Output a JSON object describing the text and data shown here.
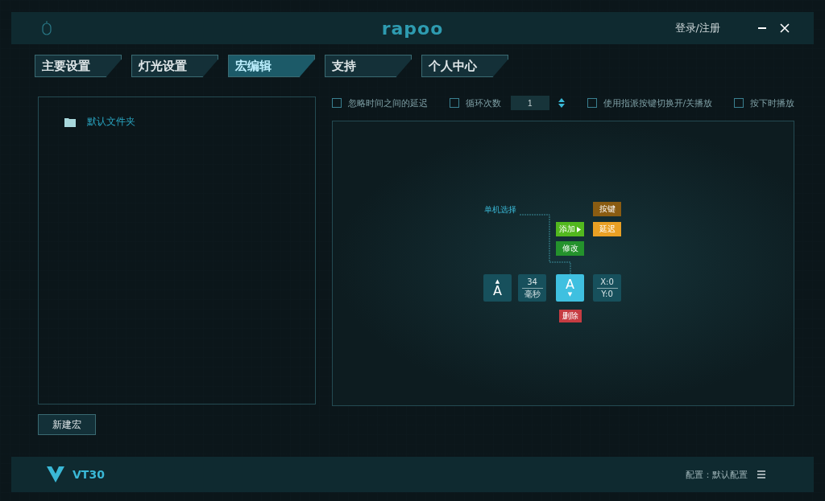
{
  "title_bar": {
    "logo": "rapoo",
    "account": "登录/注册"
  },
  "tabs": [
    {
      "label": "主要设置",
      "selected": false
    },
    {
      "label": "灯光设置",
      "selected": false
    },
    {
      "label": "宏编辑",
      "selected": true
    },
    {
      "label": "支持",
      "selected": false
    },
    {
      "label": "个人中心",
      "selected": false
    }
  ],
  "macro_list": {
    "folders": [
      {
        "name": "默认文件夹"
      }
    ],
    "new_button": "新建宏"
  },
  "options": [
    {
      "kind": "check",
      "label": "忽略时间之间的延迟",
      "checked": false
    },
    {
      "kind": "counter",
      "label": "循环次数",
      "checked": false,
      "value": "1"
    },
    {
      "kind": "check",
      "label": "使用指派按键切换开/关播放",
      "checked": false
    },
    {
      "kind": "check",
      "label": "按下时播放",
      "checked": false
    }
  ],
  "editor": {
    "hint": "单机选择",
    "actions": [
      {
        "kind": "key",
        "label": "按键",
        "color": "#8a5c12"
      },
      {
        "kind": "add",
        "label": "添加",
        "color": "#52b81e"
      },
      {
        "kind": "delay",
        "label": "延迟",
        "color": "#e9a024"
      },
      {
        "kind": "modify",
        "label": "修改",
        "color": "#24922c"
      },
      {
        "kind": "delete",
        "label": "删除",
        "color": "#c63c42"
      }
    ],
    "events": [
      {
        "kind": "key",
        "key": "A",
        "arrow_top": "▲",
        "selected": false
      },
      {
        "kind": "delay",
        "value": "34",
        "unit": "毫秒"
      },
      {
        "kind": "key",
        "key": "A",
        "arrow_bottom": "▼",
        "selected": true
      },
      {
        "kind": "position",
        "x": "X:0",
        "y": "Y:0"
      }
    ]
  },
  "footer": {
    "device": "VT30",
    "profile": "配置：默认配置"
  }
}
